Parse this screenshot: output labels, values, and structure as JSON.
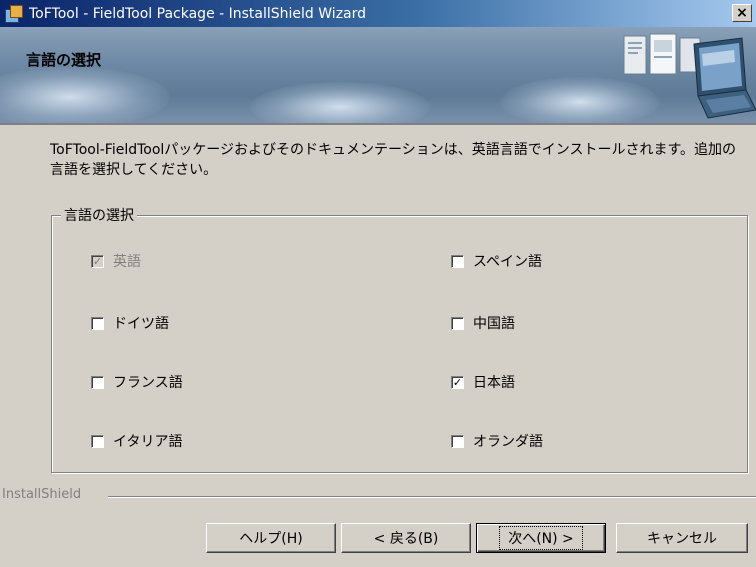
{
  "window": {
    "title": "ToFTool - FieldTool Package - InstallShield Wizard",
    "close_glyph": "×"
  },
  "banner": {
    "title": "言語の選択"
  },
  "intro_text": "ToFTool-FieldToolパッケージおよびそのドキュメンテーションは、英語言語でインストールされます。追加の言語を選択してください。",
  "group": {
    "legend": "言語の選択",
    "options": [
      {
        "label": "英語",
        "checked": true,
        "disabled": true
      },
      {
        "label": "スペイン語",
        "checked": false,
        "disabled": false
      },
      {
        "label": "ドイツ語",
        "checked": false,
        "disabled": false
      },
      {
        "label": "中国語",
        "checked": false,
        "disabled": false
      },
      {
        "label": "フランス語",
        "checked": false,
        "disabled": false
      },
      {
        "label": "日本語",
        "checked": true,
        "disabled": false
      },
      {
        "label": "イタリア語",
        "checked": false,
        "disabled": false
      },
      {
        "label": "オランダ語",
        "checked": false,
        "disabled": false
      }
    ]
  },
  "footer": {
    "brand": "InstallShield",
    "help_label": "ヘルプ(H)",
    "back_label": "< 戻る(B)",
    "next_label": "次へ(N) >",
    "cancel_label": "キャンセル"
  },
  "checkmark_glyph": "✓"
}
